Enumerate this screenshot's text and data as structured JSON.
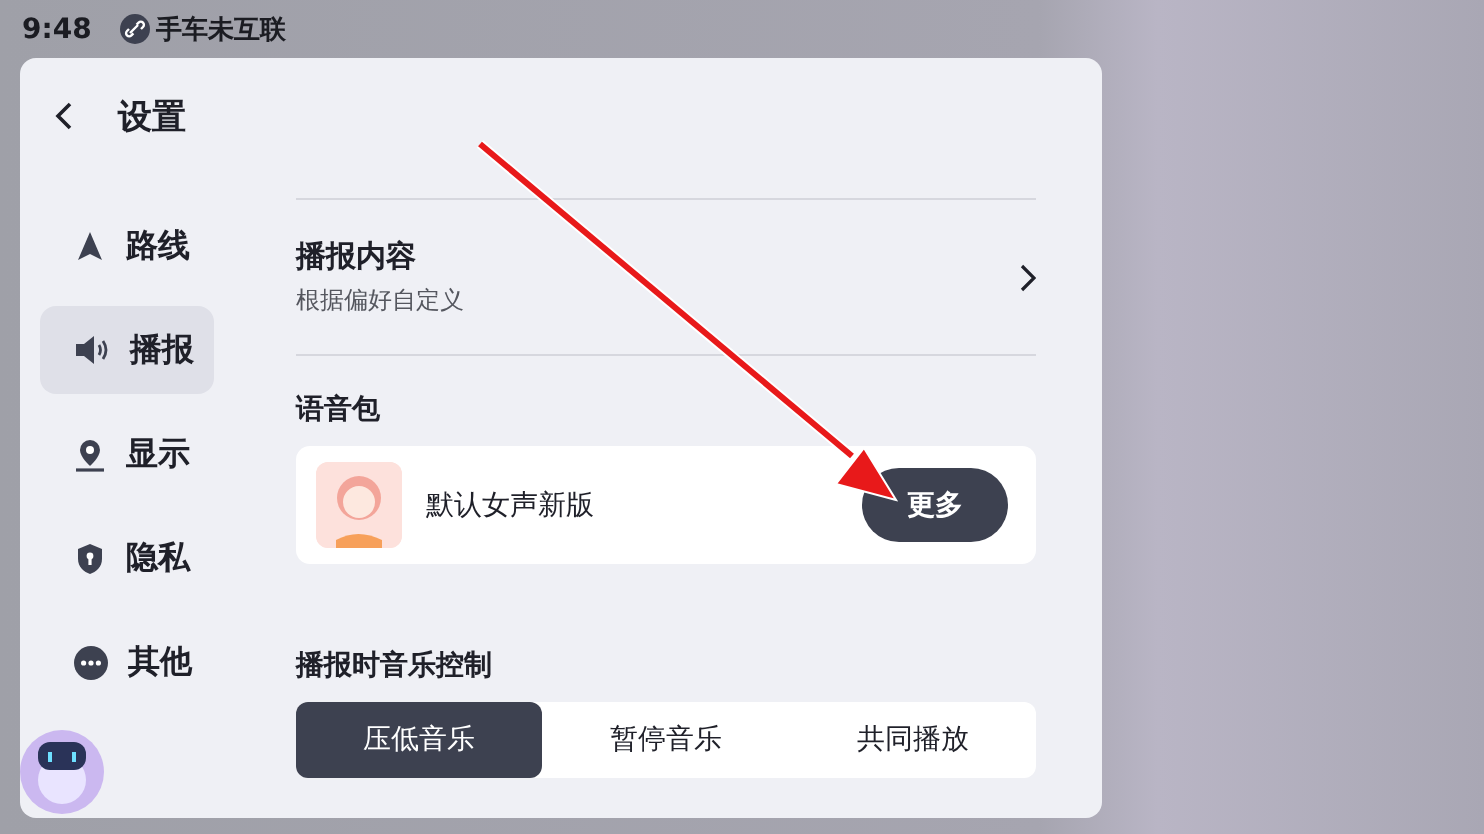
{
  "status_bar": {
    "time": "9:48",
    "connection": "手车未互联"
  },
  "settings": {
    "title": "设置",
    "sidebar": {
      "items": [
        {
          "label": "路线",
          "selected": false
        },
        {
          "label": "播报",
          "selected": true
        },
        {
          "label": "显示",
          "selected": false
        },
        {
          "label": "隐私",
          "selected": false
        },
        {
          "label": "其他",
          "selected": false
        }
      ]
    },
    "broadcast_content": {
      "title": "播报内容",
      "subtitle": "根据偏好自定义"
    },
    "voice_pack": {
      "heading": "语音包",
      "name": "默认女声新版",
      "button": "更多"
    },
    "music_control": {
      "heading": "播报时音乐控制",
      "options": [
        {
          "label": "压低音乐",
          "selected": true
        },
        {
          "label": "暂停音乐",
          "selected": false
        },
        {
          "label": "共同播放",
          "selected": false
        }
      ]
    }
  }
}
